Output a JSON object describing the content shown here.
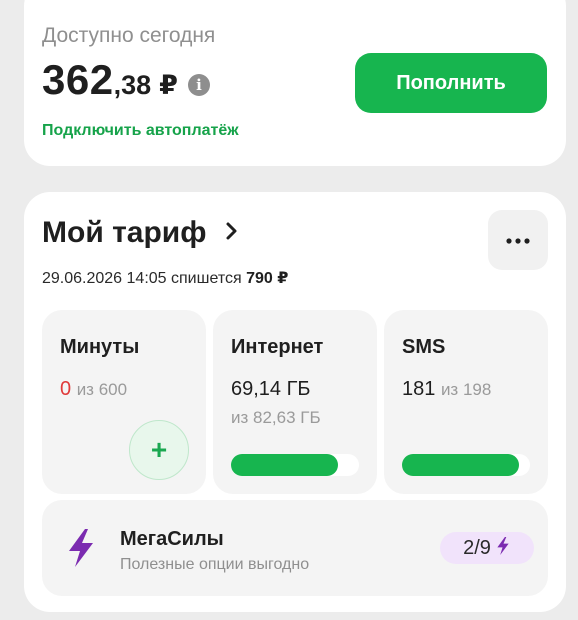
{
  "balance": {
    "label": "Доступно сегодня",
    "amount_integer": "362",
    "amount_fraction": ",38",
    "currency": "₽",
    "info_icon": "i",
    "autopay_link": "Подключить автоплатёж",
    "topup_button": "Пополнить"
  },
  "tariff": {
    "title": "Мой тариф",
    "charge_date": "29.06.2026 14:05",
    "charge_text": "спишется",
    "charge_amount": "790 ₽",
    "tiles": {
      "minutes": {
        "title": "Минуты",
        "value": "0",
        "of_text": "из 600",
        "add_label": "+"
      },
      "internet": {
        "title": "Интернет",
        "value": "69,14 ГБ",
        "sub": "из 82,63 ГБ",
        "remaining_fraction": 0.837
      },
      "sms": {
        "title": "SMS",
        "value": "181",
        "of_text": "из 198",
        "remaining_fraction": 0.914
      }
    },
    "megasily": {
      "title": "МегаСилы",
      "subtitle": "Полезные опции выгодно",
      "badge": "2/9"
    }
  },
  "colors": {
    "accent_green": "#17b54f",
    "purple": "#7b2bb0",
    "red": "#e03a3a"
  },
  "icons": [
    "info-icon",
    "chevron-right-icon",
    "more-dots-icon",
    "plus-icon",
    "lightning-icon"
  ]
}
